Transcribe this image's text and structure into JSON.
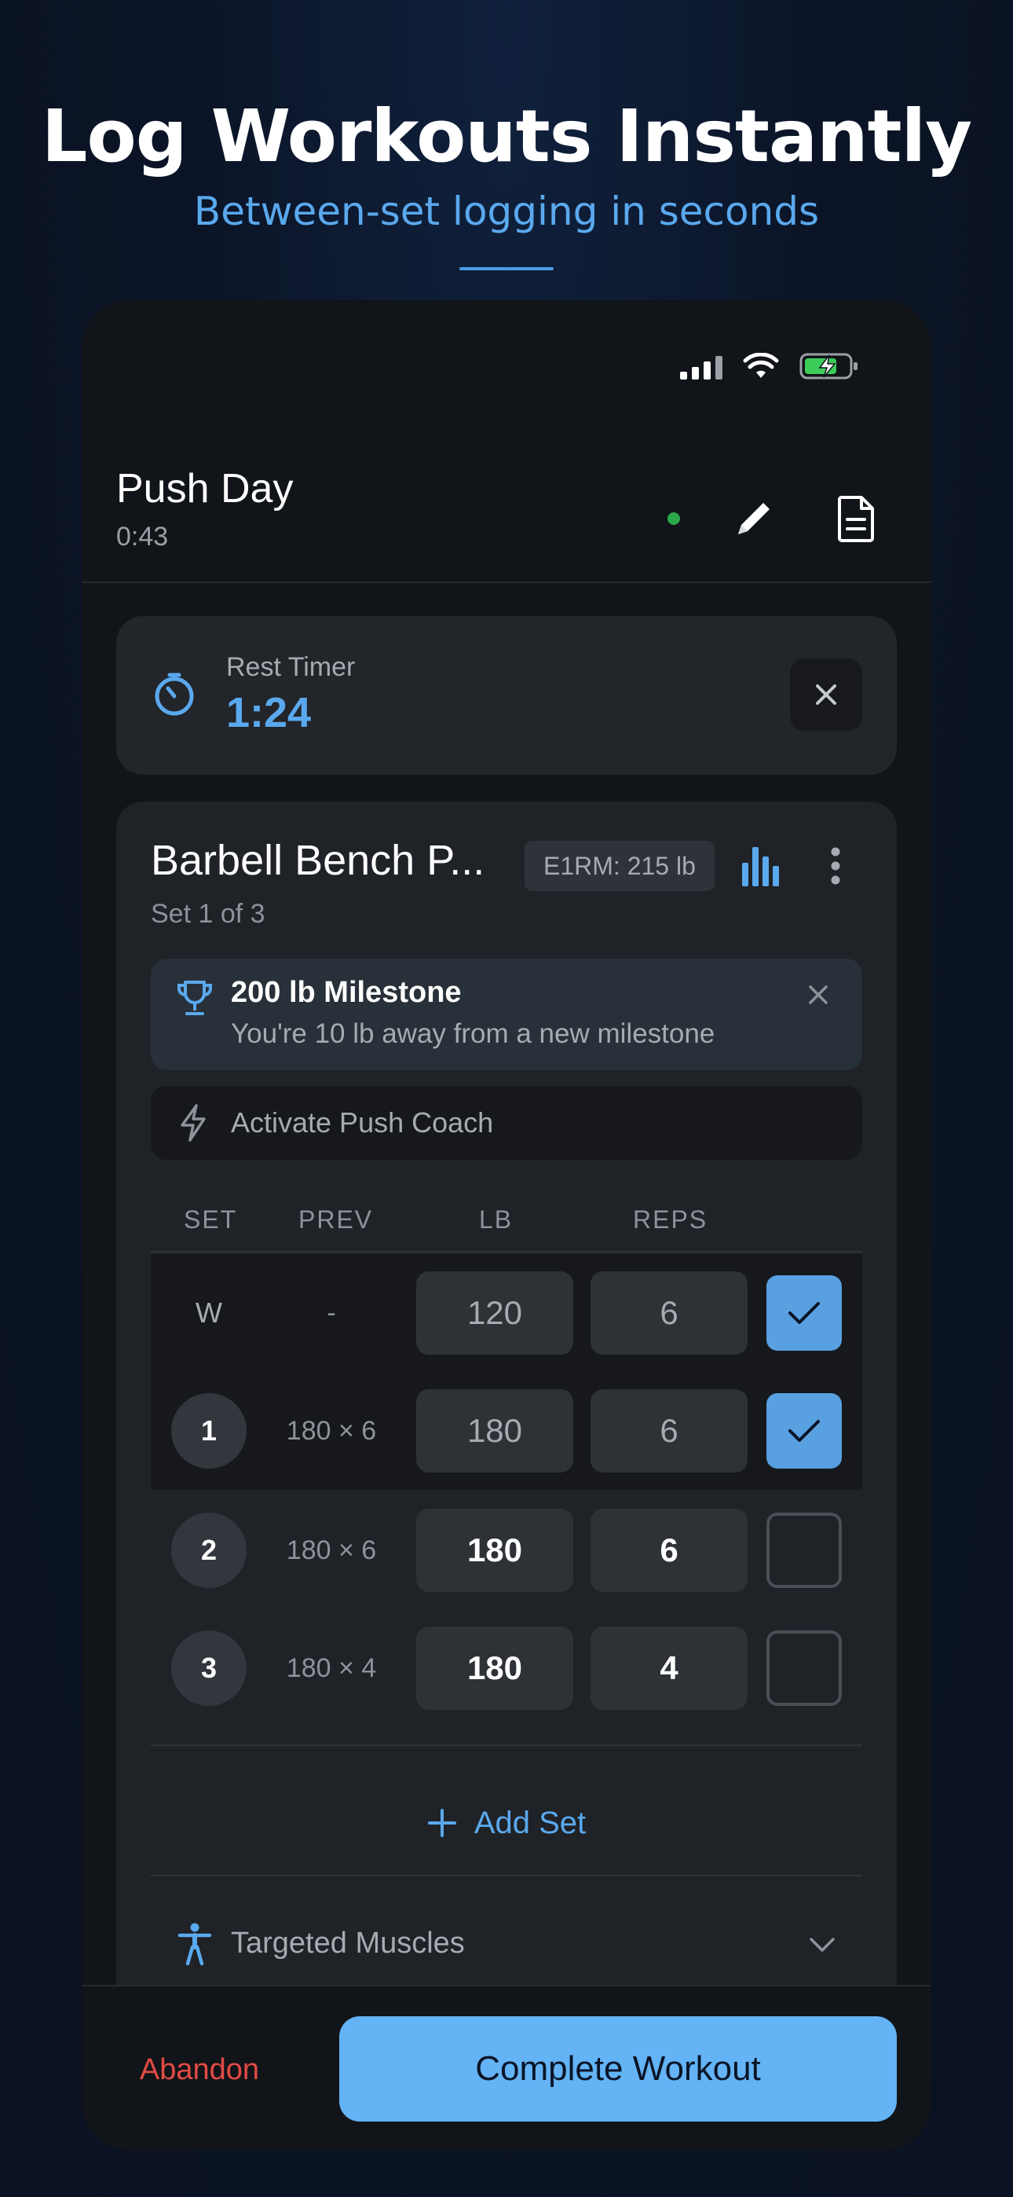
{
  "marketing": {
    "headline": "Log Workouts Instantly",
    "subheadline": "Between-set logging in seconds"
  },
  "workout": {
    "title": "Push Day",
    "elapsed": "0:43",
    "live_status_color": "#2aa84a"
  },
  "rest_timer": {
    "label": "Rest Timer",
    "value": "1:24"
  },
  "exercise": {
    "name": "Barbell Bench P...",
    "progress": "Set 1 of 3",
    "e1rm": "E1RM: 215 lb",
    "milestone": {
      "title": "200 lb Milestone",
      "subtitle": "You're 10 lb away from a new milestone"
    },
    "coach_label": "Activate Push Coach",
    "columns": {
      "set": "SET",
      "prev": "PREV",
      "lb": "LB",
      "reps": "REPS"
    },
    "sets": [
      {
        "set": "W",
        "prev": "-",
        "lb": "120",
        "reps": "6",
        "completed": true
      },
      {
        "set": "1",
        "prev": "180 × 6",
        "lb": "180",
        "reps": "6",
        "completed": true
      },
      {
        "set": "2",
        "prev": "180 × 6",
        "lb": "180",
        "reps": "6",
        "completed": false
      },
      {
        "set": "3",
        "prev": "180 × 4",
        "lb": "180",
        "reps": "4",
        "completed": false
      }
    ],
    "add_set_label": "Add Set",
    "targeted_muscles_label": "Targeted Muscles"
  },
  "footer": {
    "abandon_label": "Abandon",
    "complete_label": "Complete Workout"
  },
  "colors": {
    "accent": "#5aa9ee",
    "primary_button": "#63b3f5",
    "danger": "#e24b45",
    "background": "#0b1426"
  }
}
